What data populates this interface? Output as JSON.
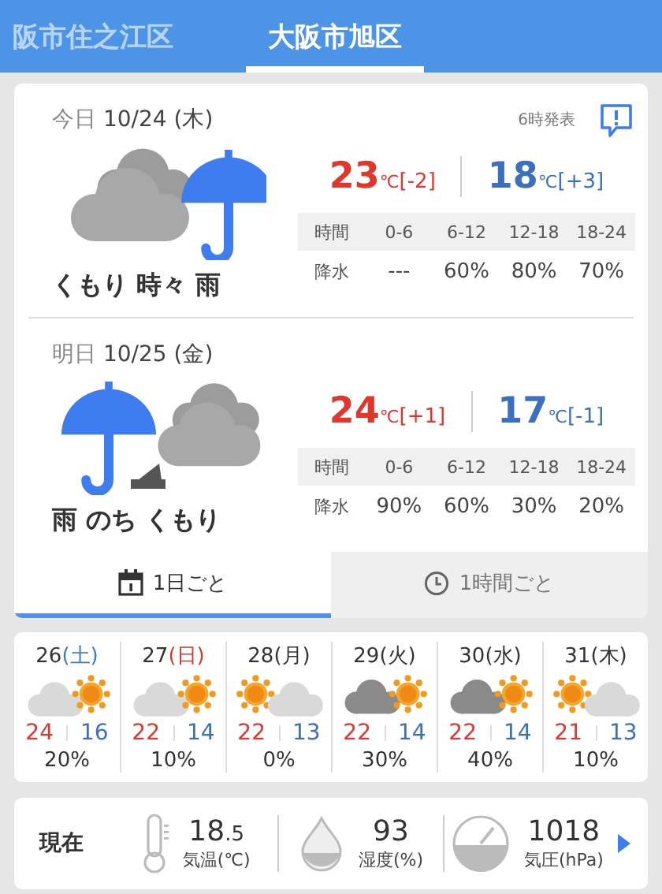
{
  "tabs": [
    {
      "label": "阪市住之江区",
      "selected": false
    },
    {
      "label": "大阪市旭区",
      "selected": true
    }
  ],
  "forecast": {
    "announce": "6時発表",
    "days": [
      {
        "day": "今日",
        "date": "10/24 (木)",
        "kind": "cloudy-rain",
        "condition": "くもり 時々 雨",
        "high": "23",
        "high_unit": "℃",
        "high_diff": "[-2]",
        "low": "18",
        "low_unit": "℃",
        "low_diff": "[+3]",
        "header": [
          "時間",
          "0-6",
          "6-12",
          "12-18",
          "18-24"
        ],
        "rain": [
          "降水",
          "---",
          "60%",
          "80%",
          "70%"
        ]
      },
      {
        "day": "明日",
        "date": "10/25 (金)",
        "kind": "rain-then-cloudy",
        "condition": "雨 のち くもり",
        "high": "24",
        "high_unit": "℃",
        "high_diff": "[+1]",
        "low": "17",
        "low_unit": "℃",
        "low_diff": "[-1]",
        "header": [
          "時間",
          "0-6",
          "6-12",
          "12-18",
          "18-24"
        ],
        "rain": [
          "降水",
          "90%",
          "60%",
          "30%",
          "20%"
        ]
      }
    ],
    "views": [
      {
        "label": "1日ごと",
        "kind": "daily",
        "selected": true
      },
      {
        "label": "1時間ごと",
        "kind": "hourly",
        "selected": false
      }
    ]
  },
  "week": [
    {
      "date": "26",
      "weekday": "(土)",
      "color": "#3b78c8",
      "kind": "cloud-sun",
      "high": "24",
      "low": "16",
      "rain": "20%"
    },
    {
      "date": "27",
      "weekday": "(日)",
      "color": "#d23a2e",
      "kind": "cloud-sun",
      "high": "22",
      "low": "14",
      "rain": "10%"
    },
    {
      "date": "28",
      "weekday": "(月)",
      "color": "#333333",
      "kind": "sun-cloud",
      "high": "22",
      "low": "13",
      "rain": "0%"
    },
    {
      "date": "29",
      "weekday": "(火)",
      "color": "#333333",
      "kind": "darkcloud-sun",
      "high": "22",
      "low": "14",
      "rain": "30%"
    },
    {
      "date": "30",
      "weekday": "(水)",
      "color": "#333333",
      "kind": "darkcloud-sun",
      "high": "22",
      "low": "14",
      "rain": "40%"
    },
    {
      "date": "31",
      "weekday": "(木)",
      "color": "#333333",
      "kind": "sun-cloud",
      "high": "21",
      "low": "13",
      "rain": "10%"
    }
  ],
  "current": {
    "label": "現在",
    "items": [
      {
        "kind": "temperature",
        "value": "18",
        "fraction": ".5",
        "label": "気温(℃)"
      },
      {
        "kind": "humidity",
        "value": "93",
        "label": "湿度(%)"
      },
      {
        "kind": "pressure",
        "value": "1018",
        "label": "気圧(hPa)"
      }
    ]
  }
}
